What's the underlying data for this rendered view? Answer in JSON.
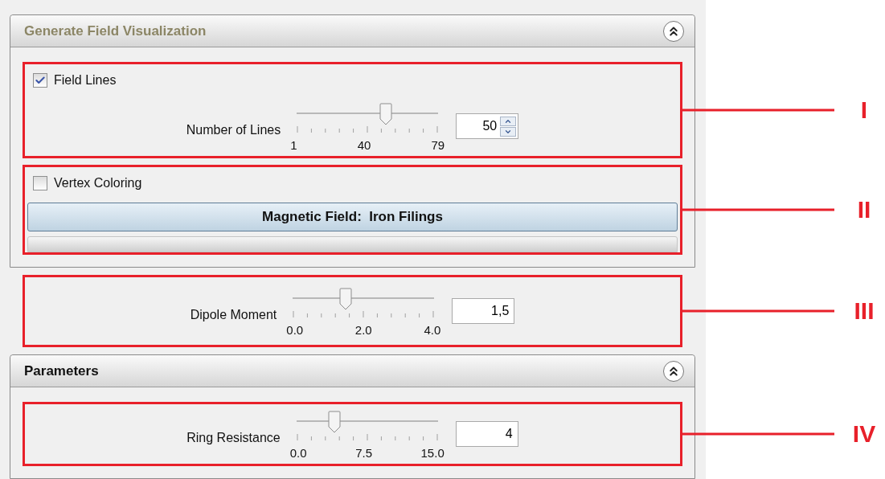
{
  "sections": [
    {
      "kind": "panel",
      "title": "Generate Field Visualization",
      "dimmed": true,
      "expanded": true,
      "groups": [
        {
          "annotation": "I",
          "items": [
            {
              "kind": "checkbox",
              "label": "Field Lines",
              "checked": true
            },
            {
              "kind": "slider",
              "label": "Number of Lines",
              "level": 0.628,
              "tick_labels": [
                "1",
                "40",
                "79"
              ],
              "value": "50",
              "spinner": true
            }
          ]
        },
        {
          "annotation": "II",
          "items": [
            {
              "kind": "checkbox",
              "label": "Vertex Coloring",
              "checked": false
            },
            {
              "kind": "button",
              "label": "Magnetic Field:  Iron Filings"
            },
            {
              "kind": "bar"
            }
          ]
        }
      ]
    },
    {
      "kind": "group",
      "annotation": "III",
      "items": [
        {
          "kind": "slider",
          "label": "Dipole Moment",
          "level": 0.375,
          "tick_labels": [
            "0.0",
            "2.0",
            "4.0"
          ],
          "value": "1,5",
          "spinner": false
        }
      ]
    },
    {
      "kind": "panel",
      "title": "Parameters",
      "dimmed": false,
      "expanded": true,
      "groups": [
        {
          "annotation": "IV",
          "items": [
            {
              "kind": "slider",
              "label": "Ring Resistance",
              "level": 0.267,
              "tick_labels": [
                "0.0",
                "7.5",
                "15.0"
              ],
              "value": "4",
              "spinner": false
            }
          ]
        }
      ]
    }
  ]
}
